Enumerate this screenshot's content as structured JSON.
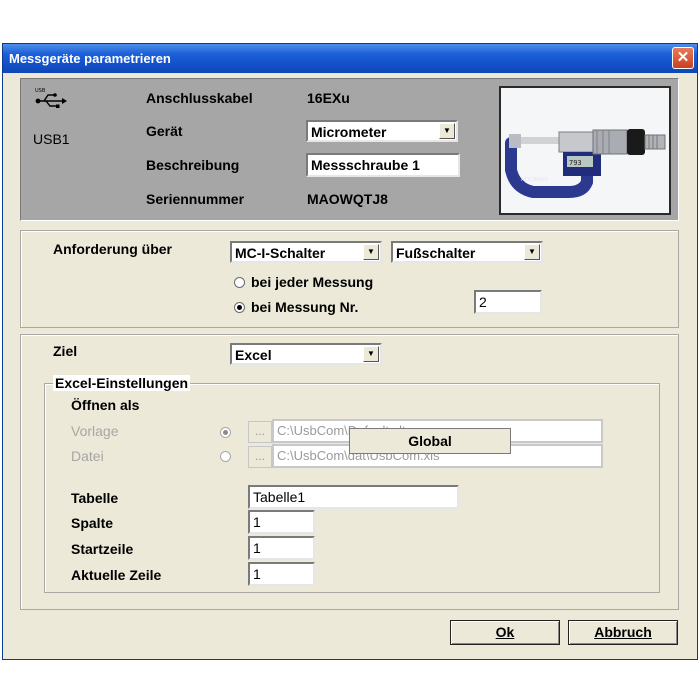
{
  "window": {
    "title": "Messgeräte parametrieren",
    "close": "✕"
  },
  "device": {
    "port": "USB1",
    "rows": [
      {
        "label": "Anschlusskabel",
        "value": "16EXu"
      },
      {
        "label": "Gerät",
        "value": "Micrometer"
      },
      {
        "label": "Beschreibung",
        "value": "Messschraube 1"
      },
      {
        "label": "Seriennummer",
        "value": "MAOWQTJ8"
      }
    ],
    "image_label": "ACCURACY"
  },
  "request": {
    "label": "Anforderung über",
    "source": "MC-I-Schalter",
    "switch": "Fußschalter",
    "option_each": "bei jeder Messung",
    "option_nr": "bei Messung Nr.",
    "selected": "bei Messung Nr.",
    "measure_nr": "2"
  },
  "target": {
    "label": "Ziel",
    "value": "Excel"
  },
  "excel": {
    "group_title": "Excel-Einstellungen",
    "open_as": "Öffnen als",
    "template_label": "Vorlage",
    "template_path": "C:\\UsbCom\\Default.xlt",
    "file_label": "Datei",
    "file_path": "C:\\UsbCom\\dat\\UsbCom.xls",
    "browse": "...",
    "popup": "Global",
    "table_label": "Tabelle",
    "table_value": "Tabelle1",
    "column_label": "Spalte",
    "column_value": "1",
    "startrow_label": "Startzeile",
    "startrow_value": "1",
    "currentrow_label": "Aktuelle Zeile",
    "currentrow_value": "1"
  },
  "buttons": {
    "ok": "Ok",
    "cancel": "Abbruch"
  }
}
